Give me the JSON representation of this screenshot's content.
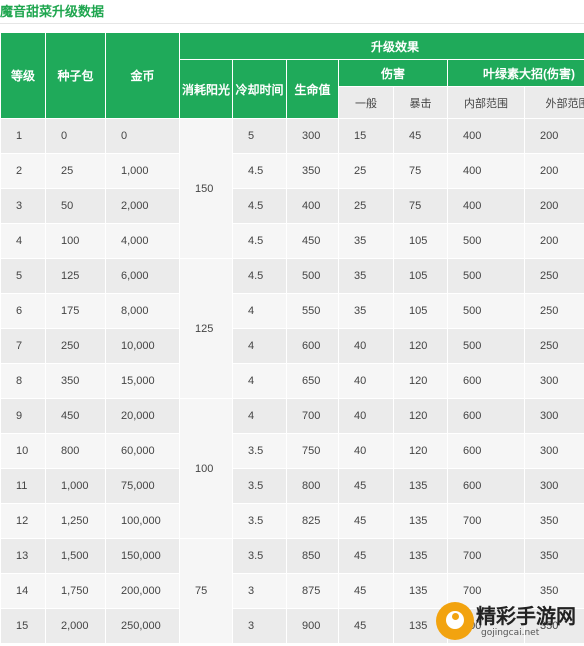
{
  "page_title": "魔音甜菜升级数据",
  "table": {
    "headers": {
      "level": "等级",
      "seed_pack": "种子包",
      "gold": "金币",
      "upgrade_effect": "升级效果",
      "sun_cost": "消耗阳光",
      "cooldown": "冷却时间",
      "health": "生命值",
      "damage": "伤害",
      "plant_food": "叶绿素大招(伤害)",
      "normal": "一般",
      "crit": "暴击",
      "inner": "内部范围",
      "outer": "外部范围"
    },
    "sun_cost_groups": [
      "150",
      "125",
      "100",
      "75"
    ],
    "rows": [
      [
        "1",
        "0",
        "0",
        "5",
        "300",
        "15",
        "45",
        "400",
        "200"
      ],
      [
        "2",
        "25",
        "1,000",
        "4.5",
        "350",
        "25",
        "75",
        "400",
        "200"
      ],
      [
        "3",
        "50",
        "2,000",
        "4.5",
        "400",
        "25",
        "75",
        "400",
        "200"
      ],
      [
        "4",
        "100",
        "4,000",
        "4.5",
        "450",
        "35",
        "105",
        "500",
        "200"
      ],
      [
        "5",
        "125",
        "6,000",
        "4.5",
        "500",
        "35",
        "105",
        "500",
        "250"
      ],
      [
        "6",
        "175",
        "8,000",
        "4",
        "550",
        "35",
        "105",
        "500",
        "250"
      ],
      [
        "7",
        "250",
        "10,000",
        "4",
        "600",
        "40",
        "120",
        "500",
        "250"
      ],
      [
        "8",
        "350",
        "15,000",
        "4",
        "650",
        "40",
        "120",
        "600",
        "300"
      ],
      [
        "9",
        "450",
        "20,000",
        "4",
        "700",
        "40",
        "120",
        "600",
        "300"
      ],
      [
        "10",
        "800",
        "60,000",
        "3.5",
        "750",
        "40",
        "120",
        "600",
        "300"
      ],
      [
        "11",
        "1,000",
        "75,000",
        "3.5",
        "800",
        "45",
        "135",
        "600",
        "300"
      ],
      [
        "12",
        "1,250",
        "100,000",
        "3.5",
        "825",
        "45",
        "135",
        "700",
        "350"
      ],
      [
        "13",
        "1,500",
        "150,000",
        "3.5",
        "850",
        "45",
        "135",
        "700",
        "350"
      ],
      [
        "14",
        "1,750",
        "200,000",
        "3",
        "875",
        "45",
        "135",
        "700",
        "350"
      ],
      [
        "15",
        "2,000",
        "250,000",
        "3",
        "900",
        "45",
        "135",
        "700",
        "350"
      ]
    ]
  },
  "watermark": {
    "name": "精彩手游网",
    "domain": "gojingcai.net",
    "logo_color": "#f2a30f"
  },
  "colors": {
    "header_green": "#1faa5a",
    "title_green": "#1fa64f",
    "row_light": "#f6f6f6",
    "row_dark": "#ebebeb"
  }
}
